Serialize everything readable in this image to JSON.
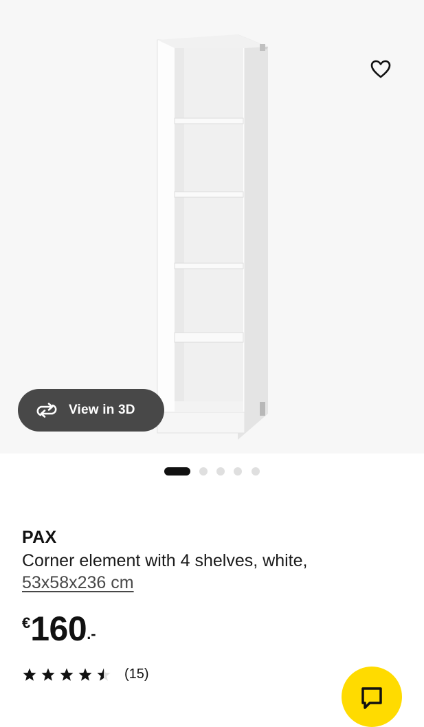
{
  "gallery": {
    "image_alt": "PAX corner element with 4 shelves, white",
    "view_3d_label": "View in 3D",
    "icons": {
      "favourite": "heart-outline-icon",
      "view_3d": "rotate-360-icon"
    },
    "slide_count": 5,
    "active_slide": 1
  },
  "product": {
    "name": "PAX",
    "description": "Corner element with 4 shelves, white,",
    "size": "53x58x236 cm",
    "price": {
      "currency": "€",
      "integer": "160",
      "decimal": ".-"
    },
    "rating": {
      "stars": 4.5,
      "max": 5,
      "count_label": "(15)"
    }
  },
  "chat": {
    "icon": "chat-bubble-icon",
    "color": "#ffdb00"
  },
  "colors": {
    "pill_bg": "#484848",
    "accent": "#ffdb00",
    "text": "#111111",
    "image_bg": "#f7f7f7"
  }
}
